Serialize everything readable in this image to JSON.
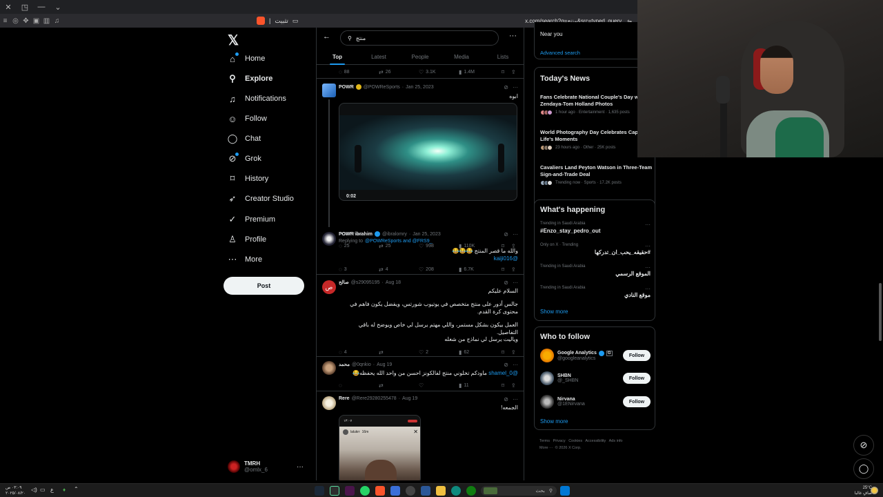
{
  "browser": {
    "pin_label": "تثبيت",
    "url": "x.com/search?q=منتج&src=typed_query"
  },
  "nav": {
    "logo": "𝕏",
    "items": [
      {
        "label": "Home",
        "icon": "home-icon"
      },
      {
        "label": "Explore",
        "icon": "search-icon"
      },
      {
        "label": "Notifications",
        "icon": "bell-icon"
      },
      {
        "label": "Follow",
        "icon": "person-add-icon"
      },
      {
        "label": "Chat",
        "icon": "chat-icon"
      },
      {
        "label": "Grok",
        "icon": "grok-icon"
      },
      {
        "label": "History",
        "icon": "bookmark-icon"
      },
      {
        "label": "Creator Studio",
        "icon": "rocket-icon"
      },
      {
        "label": "Premium",
        "icon": "verified-icon"
      },
      {
        "label": "Profile",
        "icon": "person-icon"
      },
      {
        "label": "More",
        "icon": "more-circle-icon"
      }
    ],
    "post_label": "Post",
    "account": {
      "name": "TMRH",
      "handle": "@omlx_6"
    }
  },
  "search": {
    "query": "منتج",
    "tabs": [
      "Top",
      "Latest",
      "People",
      "Media",
      "Lists"
    ],
    "active_tab": "Top"
  },
  "tweets": [
    {
      "id": "t0",
      "stats": {
        "replies": "88",
        "reposts": "26",
        "likes": "3.1K",
        "views": "1.4M"
      }
    },
    {
      "id": "t1",
      "name": "POWR",
      "handle": "@POWReSports",
      "date": "Jan 25, 2023",
      "text": "ابوه",
      "video_duration": "0:02",
      "video_caption": "POWR Fans",
      "stats": {
        "replies": "25",
        "reposts": "25",
        "likes": "998",
        "views": "110K"
      }
    },
    {
      "id": "t2",
      "name": "POWR ibrahim",
      "handle": "@ibralomry",
      "date": "Jan 25, 2023",
      "replying_prefix": "Replying to",
      "replying_to": "@POWReSports and @FRS9_",
      "text": "والله ما قصر المنتج 😂😂😂",
      "mention": "@kaiji016",
      "stats": {
        "replies": "3",
        "reposts": "4",
        "likes": "208",
        "views": "6.7K"
      }
    },
    {
      "id": "t3",
      "name": "صالح",
      "handle": "@s29095195",
      "date": "Aug 18",
      "lines": [
        "السلام عليكم",
        "جالس أدور على منتج متخصص في يوتيوب شورتس، ويفضل يكون فاهم في محتوى كرة القدم.",
        "العمل بيكون بشكل مستمر، واللي مهتم يرسل لي خاص ويوضح له باقي التفاصيل.",
        "وياليت يرسل لي نماذج من شغله"
      ],
      "stats": {
        "replies": "4",
        "reposts": "",
        "likes": "2",
        "views": "62"
      }
    },
    {
      "id": "t4",
      "name": "محمد",
      "handle": "@0qnkio",
      "date": "Aug 19",
      "mention": "@shamel_0",
      "text": "ماودكم تخلوني منتج لفالكونز احسن من واحد الله يحفظه😂",
      "stats": {
        "replies": "",
        "reposts": "",
        "likes": "",
        "views": "11"
      }
    },
    {
      "id": "t5",
      "name": "Rere",
      "handle": "@Rere29280255478",
      "date": "Aug 19",
      "text": "الجمعه!",
      "phone_time": "١٣:٠٧",
      "story_user": "lalukrr",
      "story_time": "16m"
    }
  ],
  "right": {
    "near_you": "Near you",
    "advanced_search": "Advanced search",
    "news_title": "Today's News",
    "news": [
      {
        "title": "Fans Celebrate National Couple's Day with Zendaya-Tom Holland Photos",
        "meta": "1 hour ago · Entertainment · 1,635 posts"
      },
      {
        "title": "World Photography Day Celebrates Capturing Life's Moments",
        "meta": "23 hours ago · Other · 25K posts"
      },
      {
        "title": "Cavaliers Land Peyton Watson in Three-Team Sign-and-Trade Deal",
        "meta": "Trending now · Sports · 17.2K posts"
      }
    ],
    "happening_title": "What's happening",
    "trends": [
      {
        "meta": "Trending in Saudi Arabia",
        "name": "#Enzo_stay_pedro_out"
      },
      {
        "meta": "Only on X · Trending",
        "name": "#حقيقه_يحب_ان_تدركها"
      },
      {
        "meta": "Trending in Saudi Arabia",
        "name": "الموقع الرسمي"
      },
      {
        "meta": "Trending in Saudi Arabia",
        "name": "موقع النادي"
      }
    ],
    "show_more": "Show more",
    "wtf_title": "Who to follow",
    "wtf": [
      {
        "name": "Google Analytics",
        "handle": "@googleanalytics",
        "button": "Follow"
      },
      {
        "name": "SHBN",
        "handle": "@_SHBN",
        "button": "Follow"
      },
      {
        "name": "Nirvana",
        "handle": "@1ENirvana",
        "button": "Follow"
      }
    ],
    "footer": [
      "Terms",
      "Privacy",
      "Cookies",
      "Accessibility",
      "Ads info",
      "More ···",
      "© 2026 X Corp."
    ]
  },
  "taskbar": {
    "search_placeholder": "بحث",
    "time": "٠٣:٠٩ ص",
    "date": "٢٠٢٥/٠٨/٢٠",
    "temperature": "25°C",
    "weather": "صافٍ غالبا",
    "lang": "ع"
  },
  "colors": {
    "accent": "#1d9bf0",
    "background": "#000000",
    "border": "#2f3336",
    "muted": "#71767b",
    "verified_gold": "#e2b719"
  }
}
